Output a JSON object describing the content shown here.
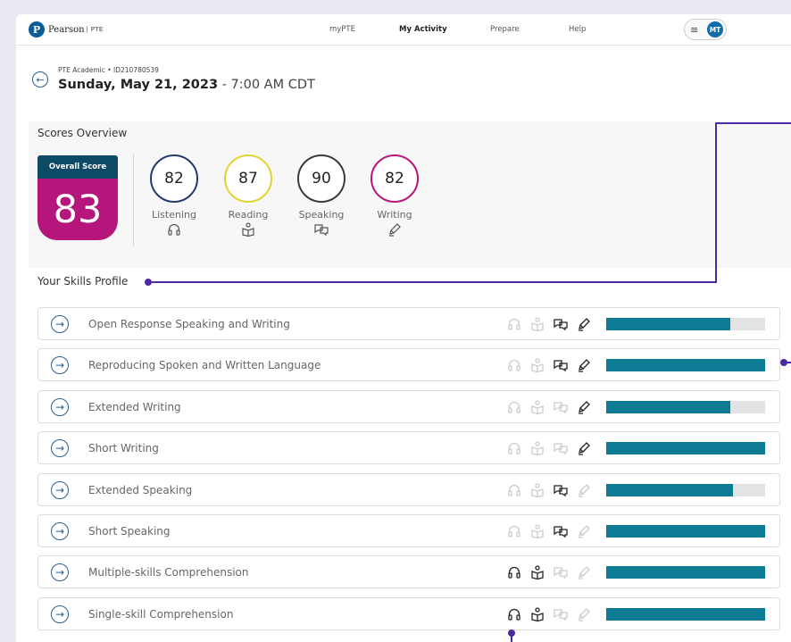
{
  "header": {
    "brand": "Pearson",
    "brand_sub": "PTE",
    "nav": [
      "myPTE",
      "My Activity",
      "Prepare",
      "Help"
    ],
    "menu_icon": "hamburger-icon",
    "avatar_initials": "MT",
    "accent": "#0b6cb0"
  },
  "exam": {
    "meta": "PTE Academic • ID210780539",
    "date": "Sunday, May 21, 2023",
    "time": " - 7:00 AM CDT"
  },
  "scores": {
    "title": "Scores Overview",
    "overall_label": "Overall Score",
    "overall_value": "83",
    "overall_color": "#b5167c",
    "skills": [
      {
        "label": "Listening",
        "value": "82",
        "color": "#243a70",
        "icon": "headphones-icon"
      },
      {
        "label": "Reading",
        "value": "87",
        "color": "#e3d234",
        "icon": "book-reader-icon"
      },
      {
        "label": "Speaking",
        "value": "90",
        "color": "#3b3b3b",
        "icon": "speech-bubbles-icon"
      },
      {
        "label": "Writing",
        "value": "82",
        "color": "#b5167c",
        "icon": "pen-icon"
      }
    ]
  },
  "profile": {
    "title": "Your Skills Profile",
    "bar_color": "#0e7b94",
    "rows": [
      {
        "label": "Open Response Speaking and Writing",
        "skills": [
          false,
          false,
          true,
          true
        ],
        "fill": 0.78
      },
      {
        "label": "Reproducing Spoken and Written Language",
        "skills": [
          false,
          false,
          true,
          true
        ],
        "fill": 1.0
      },
      {
        "label": "Extended Writing",
        "skills": [
          false,
          false,
          false,
          true
        ],
        "fill": 0.78
      },
      {
        "label": "Short Writing",
        "skills": [
          false,
          false,
          false,
          true
        ],
        "fill": 1.0
      },
      {
        "label": "Extended Speaking",
        "skills": [
          false,
          false,
          true,
          false
        ],
        "fill": 0.8
      },
      {
        "label": "Short Speaking",
        "skills": [
          false,
          false,
          true,
          false
        ],
        "fill": 1.0
      },
      {
        "label": "Multiple-skills Comprehension",
        "skills": [
          true,
          true,
          false,
          false
        ],
        "fill": 1.0
      },
      {
        "label": "Single-skill Comprehension",
        "skills": [
          true,
          true,
          false,
          false
        ],
        "fill": 1.0
      }
    ]
  },
  "annotation_color": "#4b2aa1"
}
